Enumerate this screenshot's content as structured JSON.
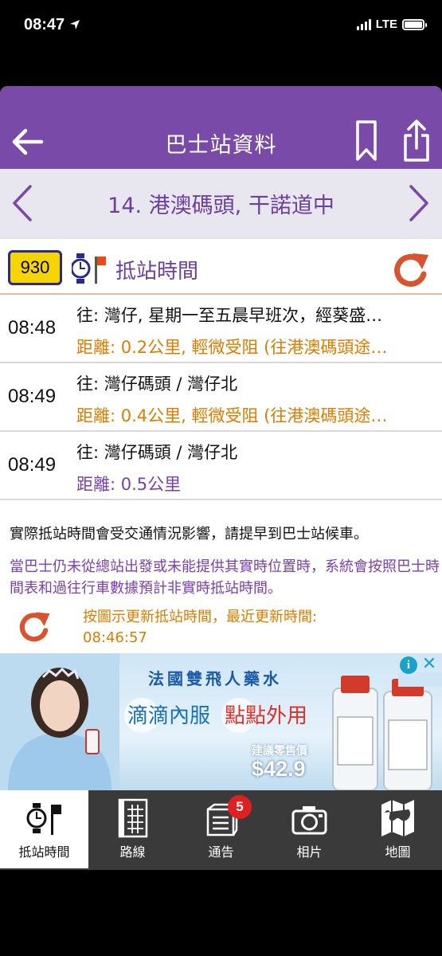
{
  "status_bar": {
    "time": "08:47",
    "network": "LTE"
  },
  "header": {
    "title": "巴士站資料"
  },
  "stop": {
    "name": "14. 港澳碼頭, 干諾道中"
  },
  "eta": {
    "route": "930",
    "title": "抵站時間",
    "rows": [
      {
        "time": "08:48",
        "dest": "往: 灣仔, 星期一至五晨早班次，經葵盛…",
        "dist": "距離: 0.2公里, 輕微受阻 (往港澳碼頭途…",
        "dist_color": "#e07b00"
      },
      {
        "time": "08:49",
        "dest": "往: 灣仔碼頭 / 灣仔北",
        "dist": "距離: 0.4公里, 輕微受阻 (往港澳碼頭途…",
        "dist_color": "#e07b00"
      },
      {
        "time": "08:49",
        "dest": "往: 灣仔碼頭 / 灣仔北",
        "dist": "距離: 0.5公里",
        "dist_color": "#7b3fb0"
      }
    ]
  },
  "notes": {
    "note1": "實際抵站時間會受交通情況影響，請提早到巴士站候車。",
    "note2": "當巴士仍未從總站出發或未能提供其實時位置時，系統會按照巴士時間表和過往行車數據預計非實時抵站時間。",
    "refresh_line1": "按圖示更新抵站時間，最近更新時間:",
    "refresh_line2": "08:46:57"
  },
  "ad": {
    "headline": "法國雙飛人藥水",
    "slogan_left": "滴滴內服",
    "slogan_right": "點點外用",
    "price_label": "建議零售價",
    "price": "$42.9"
  },
  "tabs": [
    {
      "label": "抵站時間",
      "icon": "watch-flag-icon",
      "active": true
    },
    {
      "label": "路線",
      "icon": "route-grid-icon",
      "active": false
    },
    {
      "label": "通告",
      "icon": "notice-icon",
      "active": false,
      "badge": "5"
    },
    {
      "label": "相片",
      "icon": "camera-icon",
      "active": false
    },
    {
      "label": "地圖",
      "icon": "map-icon",
      "active": false
    }
  ],
  "colors": {
    "brand_purple": "#7a4aa8",
    "accent_orange": "#e07b00",
    "refresh_red": "#d9532f"
  }
}
